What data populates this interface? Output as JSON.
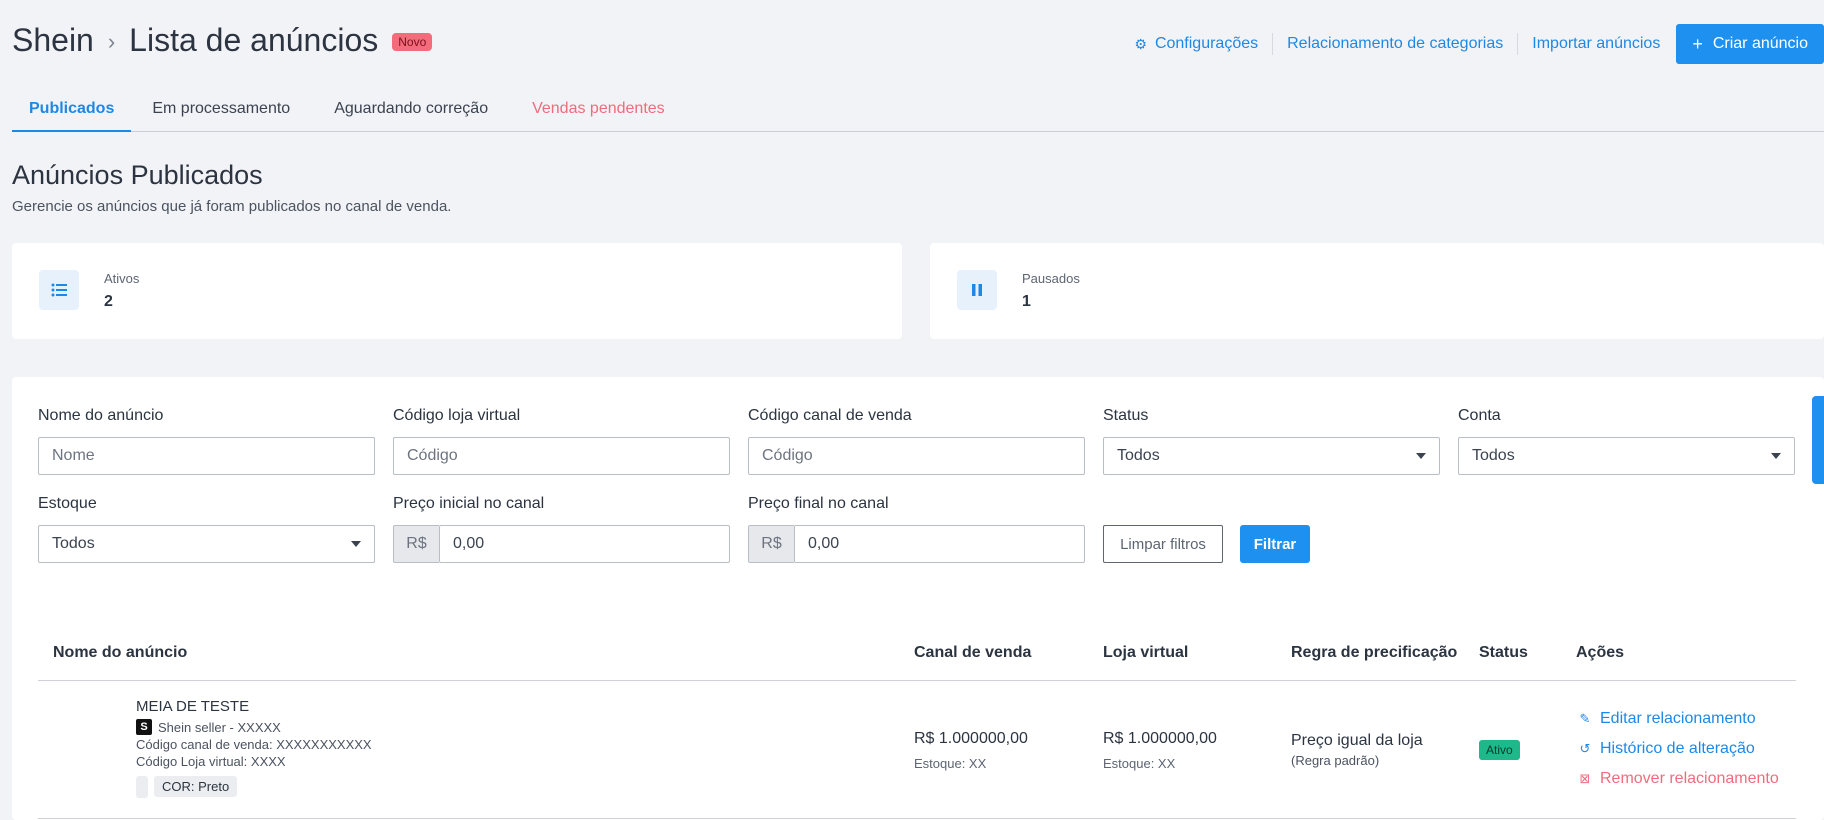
{
  "breadcrumb": {
    "root": "Shein",
    "separator": "›",
    "current": "Lista de anúncios",
    "badge": "Novo"
  },
  "header_actions": {
    "settings": "Configurações",
    "categories": "Relacionamento de categorias",
    "import": "Importar anúncios",
    "create": "Criar anúncio"
  },
  "tabs": [
    {
      "label": "Publicados",
      "active": true
    },
    {
      "label": "Em processamento"
    },
    {
      "label": "Aguardando correção"
    },
    {
      "label": "Vendas pendentes"
    }
  ],
  "section": {
    "title": "Anúncios Publicados",
    "subtitle": "Gerencie os anúncios que já foram publicados no canal de venda."
  },
  "stats": [
    {
      "label": "Ativos",
      "value": "2",
      "icon": "list-icon"
    },
    {
      "label": "Pausados",
      "value": "1",
      "icon": "pause-icon"
    }
  ],
  "filters": {
    "name": {
      "label": "Nome do anúncio",
      "placeholder": "Nome"
    },
    "store_code": {
      "label": "Código loja virtual",
      "placeholder": "Código"
    },
    "channel_code": {
      "label": "Código canal de venda",
      "placeholder": "Código"
    },
    "status": {
      "label": "Status",
      "value": "Todos"
    },
    "account": {
      "label": "Conta",
      "value": "Todos"
    },
    "stock": {
      "label": "Estoque",
      "value": "Todos"
    },
    "price_min": {
      "label": "Preço inicial no canal",
      "prefix": "R$",
      "value": "0,00"
    },
    "price_max": {
      "label": "Preço final no canal",
      "prefix": "R$",
      "value": "0,00"
    },
    "clear_label": "Limpar filtros",
    "filter_label": "Filtrar"
  },
  "table": {
    "headers": [
      "Nome do anúncio",
      "Canal de venda",
      "Loja virtual",
      "Regra de precificação",
      "Status",
      "Ações"
    ],
    "row": {
      "name": "MEIA DE TESTE",
      "seller_badge": "S",
      "seller": "Shein seller - XXXXX",
      "channel_code": "Código canal de venda: XXXXXXXXXXX",
      "store_code": "Código Loja virtual: XXXX",
      "variant": "COR: Preto",
      "channel_price": "R$ 1.000000,00",
      "channel_stock": "Estoque: XX",
      "store_price": "R$ 1.000000,00",
      "store_stock": "Estoque: XX",
      "rule": "Preço igual da loja",
      "rule_note": "(Regra padrão)",
      "status": "Ativo",
      "actions": {
        "edit": "Editar relacionamento",
        "history": "Histórico de alteração",
        "remove": "Remover relacionamento"
      }
    }
  },
  "colors": {
    "primary": "#1e90f0",
    "danger": "#f06c7d",
    "success": "#1fb88a"
  }
}
